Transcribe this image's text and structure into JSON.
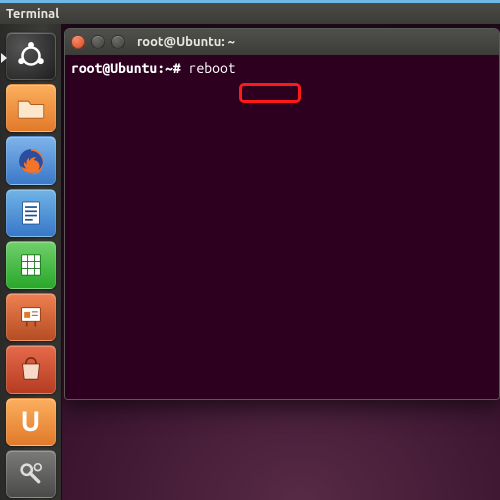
{
  "menubar": {
    "title": "Terminal"
  },
  "launcher": {
    "items": [
      {
        "name": "dash-home"
      },
      {
        "name": "files"
      },
      {
        "name": "firefox"
      },
      {
        "name": "writer"
      },
      {
        "name": "calc"
      },
      {
        "name": "impress"
      },
      {
        "name": "software-center"
      },
      {
        "name": "ubuntu-one",
        "glyph": "U"
      },
      {
        "name": "system-settings"
      }
    ]
  },
  "terminal": {
    "title": "root@Ubuntu: ~",
    "prompt": "root@Ubuntu:~#",
    "command": "reboot"
  },
  "colors": {
    "term_bg": "#2c001e",
    "highlight": "#ff1a1a"
  }
}
